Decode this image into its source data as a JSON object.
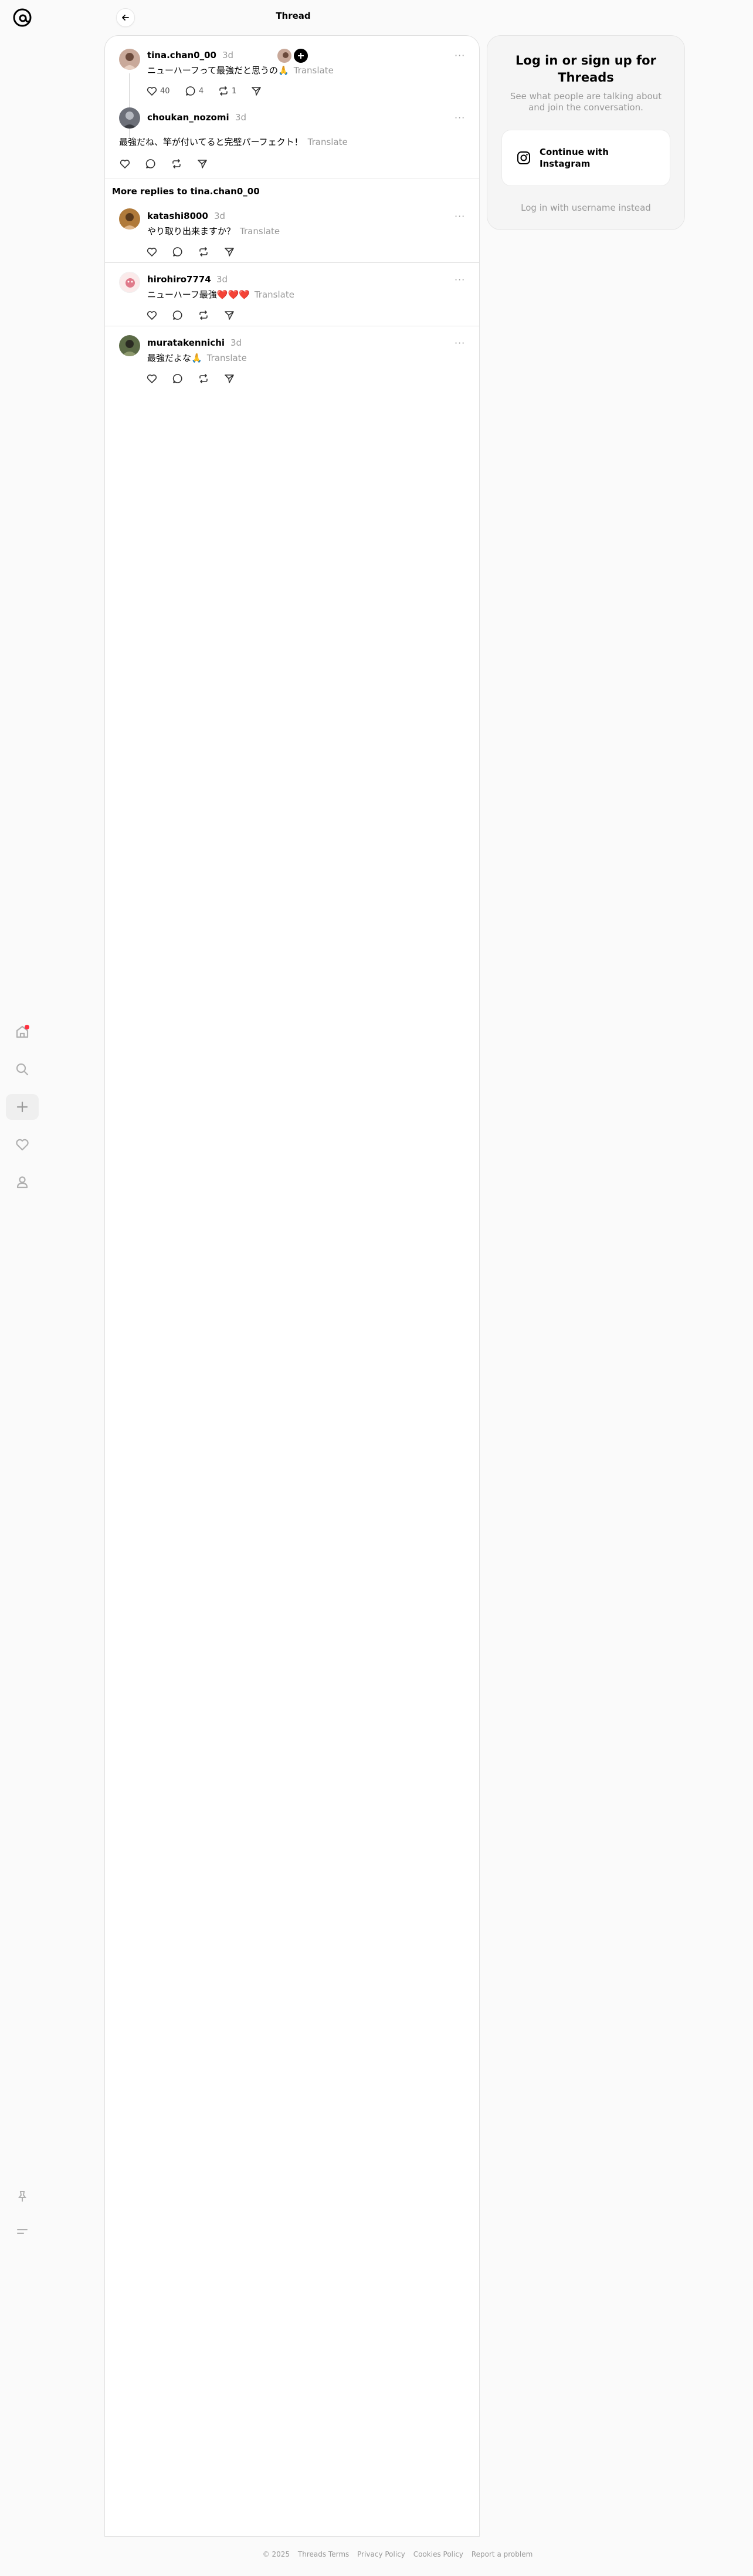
{
  "header": {
    "title": "Thread"
  },
  "main_post": {
    "username": "tina.chan0_00",
    "time": "3d",
    "text": "ニューハーフって最強だと思うの🙏",
    "translate": "Translate",
    "likes": "40",
    "replies": "4",
    "reposts": "1"
  },
  "first_reply": {
    "username": "choukan_nozomi",
    "time": "3d",
    "text": "最強だね、竿が付いてると完璧パーフェクト！",
    "translate": "Translate"
  },
  "more_replies_title": "More replies to tina.chan0_00",
  "replies": [
    {
      "username": "katashi8000",
      "time": "3d",
      "text": "やり取り出来ますか？",
      "translate": "Translate"
    },
    {
      "username": "hirohiro7774",
      "time": "3d",
      "text": "ニューハーフ最強❤️❤️❤️",
      "translate": "Translate"
    },
    {
      "username": "muratakennichi",
      "time": "3d",
      "text": "最強だよな🙏",
      "translate": "Translate"
    }
  ],
  "login": {
    "title": "Log in or sign up for Threads",
    "subtitle": "See what people are talking about and join the conversation.",
    "instagram_button": "Continue with Instagram",
    "username_link": "Log in with username instead"
  },
  "footer": {
    "copyright": "© 2025",
    "links": [
      "Threads Terms",
      "Privacy Policy",
      "Cookies Policy",
      "Report a problem"
    ]
  },
  "colors": {
    "notification_dot": "#ff3040",
    "muted": "#999999"
  }
}
